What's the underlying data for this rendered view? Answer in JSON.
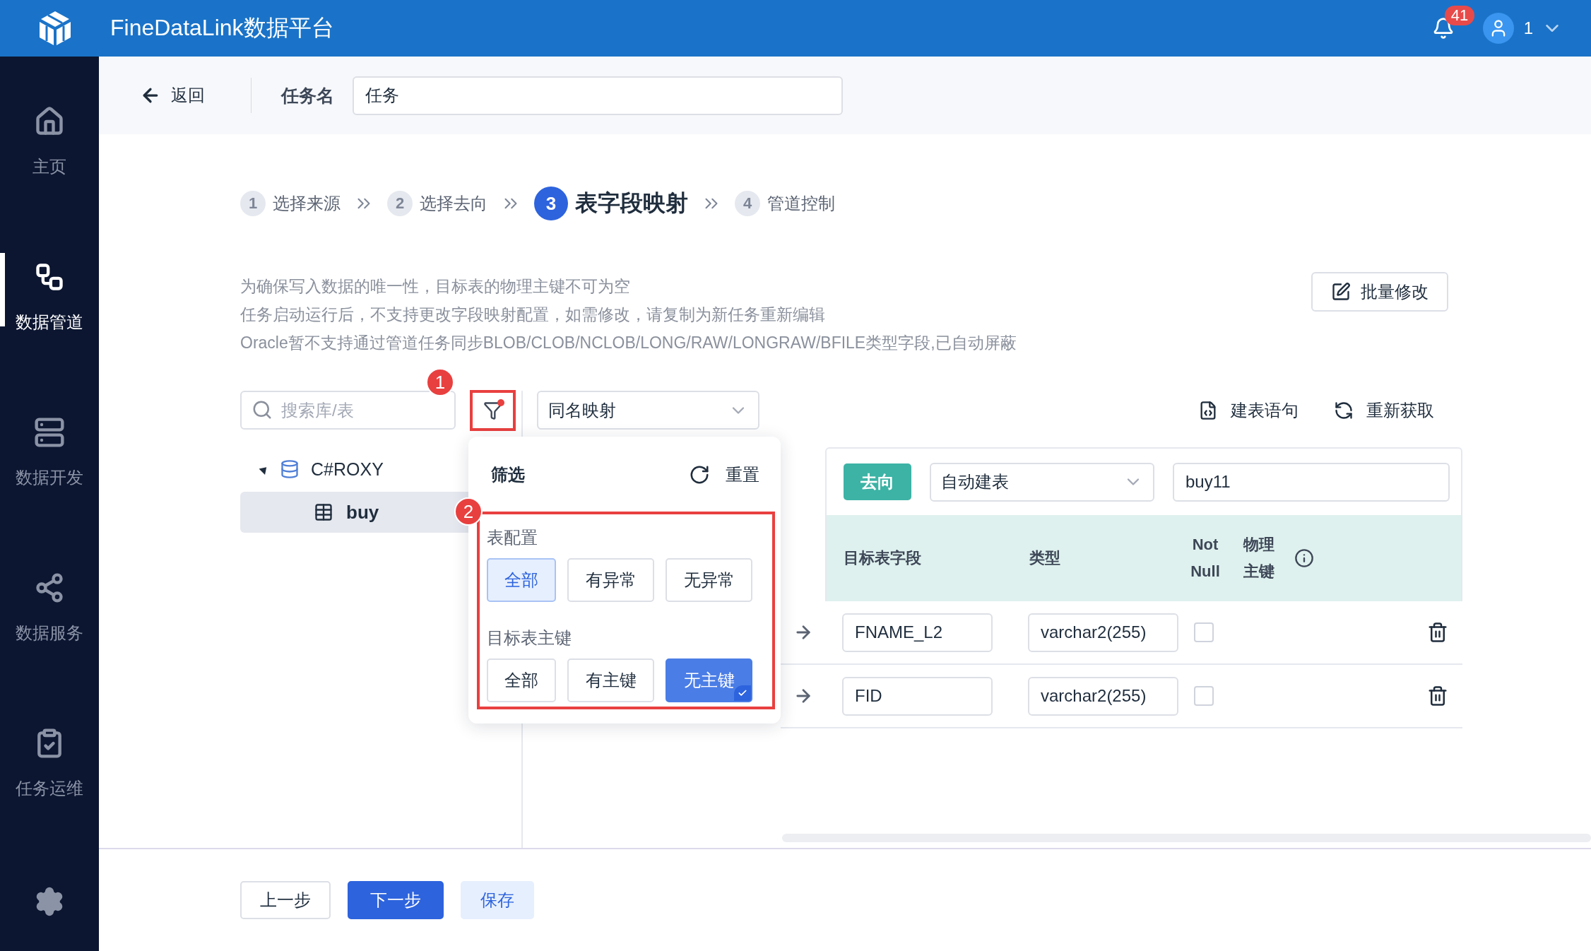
{
  "app": {
    "title": "FineDataLink数据平台",
    "notification_count": "41",
    "user": "1"
  },
  "sidebar": {
    "items": [
      {
        "label": "主页",
        "selected": false
      },
      {
        "label": "数据管道",
        "selected": true
      },
      {
        "label": "数据开发",
        "selected": false
      },
      {
        "label": "数据服务",
        "selected": false
      },
      {
        "label": "任务运维",
        "selected": false
      }
    ]
  },
  "task_bar": {
    "back": "返回",
    "name_label": "任务名",
    "name_value": "任务"
  },
  "steps": [
    {
      "number": "1",
      "label": "选择来源",
      "selected": false
    },
    {
      "number": "2",
      "label": "选择去向",
      "selected": false
    },
    {
      "number": "3",
      "label": "表字段映射",
      "selected": true
    },
    {
      "number": "4",
      "label": "管道控制",
      "selected": false
    }
  ],
  "notes": [
    "为确保写入数据的唯一性，目标表的物理主键不可为空",
    "任务启动运行后，不支持更改字段映射配置，如需修改，请复制为新任务重新编辑",
    "Oracle暂不支持通过管道任务同步BLOB/CLOB/NCLOB/LONG/RAW/LONGRAW/BFILE类型字段,已自动屏蔽"
  ],
  "batch_edit": "批量修改",
  "search": {
    "placeholder": "搜索库/表"
  },
  "filter_button": {
    "active": true
  },
  "mapping_select": "同名映射",
  "actions": [
    "建表语句",
    "重新获取"
  ],
  "tree": [
    {
      "label": "C#ROXY",
      "expanded": true,
      "children": [
        {
          "label": "buy",
          "selected": true
        }
      ]
    }
  ],
  "filter_popup": {
    "title": "筛选",
    "reset": "重置",
    "groups": [
      {
        "label": "表配置",
        "kind": "soft",
        "options": [
          {
            "label": "全部",
            "selected": true
          },
          {
            "label": "有异常",
            "selected": false
          },
          {
            "label": "无异常",
            "selected": false
          }
        ]
      },
      {
        "label": "目标表主键",
        "kind": "solid",
        "options": [
          {
            "label": "全部",
            "selected": false
          },
          {
            "label": "有主键",
            "selected": false
          },
          {
            "label": "无主键",
            "selected": true
          }
        ]
      }
    ]
  },
  "annotations": [
    "1",
    "2"
  ],
  "target": {
    "tag": "去向",
    "mode": "自动建表",
    "table": "buy11",
    "columns": [
      "目标表字段",
      "类型",
      "Not Null",
      "物理主键"
    ],
    "rows": [
      {
        "field": "FNAME_L2",
        "type": "varchar2(255)",
        "not_null": false
      },
      {
        "field": "FID",
        "type": "varchar2(255)",
        "not_null": false
      }
    ]
  },
  "footer": {
    "buttons": [
      {
        "label": "上一步",
        "kind": "default"
      },
      {
        "label": "下一步",
        "kind": "primary"
      },
      {
        "label": "保存",
        "kind": "soft"
      }
    ]
  }
}
